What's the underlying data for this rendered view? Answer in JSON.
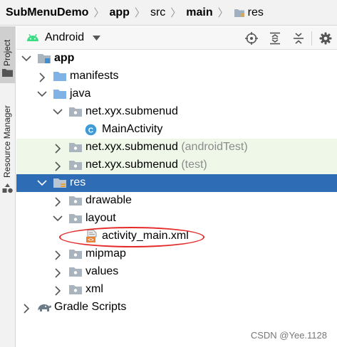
{
  "breadcrumb": {
    "items": [
      "SubMenuDemo",
      "app",
      "src",
      "main",
      "res"
    ]
  },
  "toolstrip": {
    "project_tab": "Project",
    "resource_manager_tab": "Resource Manager"
  },
  "toolbar": {
    "view_mode": "Android",
    "icons": [
      "locate-icon",
      "expand-all-icon",
      "collapse-all-icon",
      "gear-icon"
    ]
  },
  "tree": [
    {
      "label": "app",
      "expanded": true,
      "icon": "module-folder-icon"
    },
    {
      "label": "manifests",
      "expanded": false,
      "icon": "folder-icon"
    },
    {
      "label": "java",
      "expanded": true,
      "icon": "folder-icon"
    },
    {
      "label": "net.xyx.submenud",
      "expanded": true,
      "icon": "package-icon"
    },
    {
      "label": "MainActivity",
      "icon": "class-icon"
    },
    {
      "label": "net.xyx.submenud",
      "suffix": "(androidTest)",
      "expanded": false,
      "icon": "package-icon"
    },
    {
      "label": "net.xyx.submenud",
      "suffix": "(test)",
      "expanded": false,
      "icon": "package-icon"
    },
    {
      "label": "res",
      "expanded": true,
      "selected": true,
      "icon": "res-folder-icon"
    },
    {
      "label": "drawable",
      "expanded": false,
      "icon": "package-icon"
    },
    {
      "label": "layout",
      "expanded": true,
      "icon": "package-icon"
    },
    {
      "label": "activity_main.xml",
      "icon": "layout-xml-icon"
    },
    {
      "label": "mipmap",
      "expanded": false,
      "icon": "package-icon"
    },
    {
      "label": "values",
      "expanded": false,
      "icon": "package-icon"
    },
    {
      "label": "xml",
      "expanded": false,
      "icon": "package-icon"
    },
    {
      "label": "Gradle Scripts",
      "expanded": false,
      "icon": "gradle-icon"
    }
  ],
  "watermark": "CSDN @Yee.1128",
  "colors": {
    "selection": "#2e6db6",
    "test_row_bg": "#eef7e8",
    "annotation": "#e52a2a",
    "folder_blue": "#7fb2e5"
  }
}
